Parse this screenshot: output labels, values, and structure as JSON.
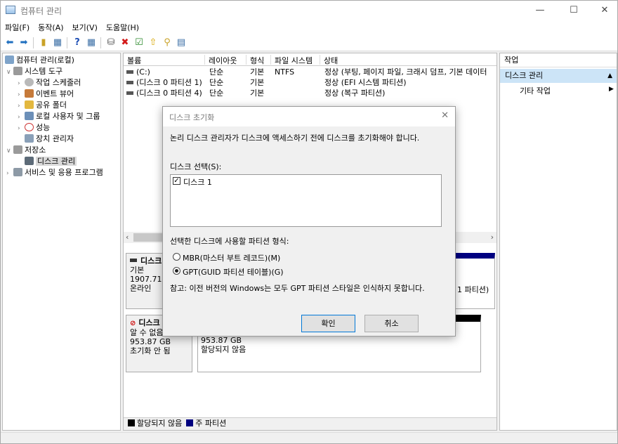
{
  "window": {
    "title": "컴퓨터 관리",
    "minimize": "—",
    "maximize": "☐",
    "close": "✕"
  },
  "menu": [
    "파일(F)",
    "동작(A)",
    "보기(V)",
    "도움말(H)"
  ],
  "tree": {
    "root": "컴퓨터 관리(로컬)",
    "system_tools": "시스템 도구",
    "task_scheduler": "작업 스케줄러",
    "event_viewer": "이벤트 뷰어",
    "shared_folders": "공유 폴더",
    "local_users": "로컬 사용자 및 그룹",
    "performance": "성능",
    "device_manager": "장치 관리자",
    "storage": "저장소",
    "disk_management": "디스크 관리",
    "services": "서비스 및 응용 프로그램"
  },
  "volumes": {
    "columns": [
      "볼륨",
      "레이아웃",
      "형식",
      "파일 시스템",
      "상태"
    ],
    "rows": [
      {
        "name": "(C:)",
        "layout": "단순",
        "type": "기본",
        "fs": "NTFS",
        "status": "정상 (부팅, 페이지 파일, 크래시 덤프, 기본 데이터"
      },
      {
        "name": "(디스크 0 파티션 1)",
        "layout": "단순",
        "type": "기본",
        "fs": "",
        "status": "정상 (EFI 시스템 파티션)"
      },
      {
        "name": "(디스크 0 파티션 4)",
        "layout": "단순",
        "type": "기본",
        "fs": "",
        "status": "정상 (복구 파티션)"
      }
    ]
  },
  "disk0": {
    "name": "디스크",
    "kind": "기본",
    "size": "1907.71 G",
    "state": "온라인",
    "part_fragment": "1 파티션)"
  },
  "disk1": {
    "name": "디스크",
    "kind": "알 수 없음",
    "size": "953.87 GB",
    "state": "초기화 안 됨",
    "part_size": "953.87 GB",
    "part_state": "할당되지 않음"
  },
  "legend": {
    "unallocated": "할당되지 않음",
    "primary": "주 파티션"
  },
  "actions": {
    "header": "작업",
    "section": "디스크 관리",
    "more": "기타 작업"
  },
  "dialog": {
    "title": "디스크 초기화",
    "message": "논리 디스크 관리자가 디스크에 액세스하기 전에 디스크를 초기화해야 합니다.",
    "select_label": "디스크 선택(S):",
    "disk_item": "디스크 1",
    "style_label": "선택한 디스크에 사용할 파티션 형식:",
    "mbr": "MBR(마스터 부트 레코드)(M)",
    "gpt": "GPT(GUID 파티션 테이블)(G)",
    "note": "참고: 이전 버전의 Windows는 모두 GPT 파티션 스타일은 인식하지 못합니다.",
    "ok": "확인",
    "cancel": "취소"
  },
  "colors": {
    "accent": "#0078d7",
    "primary_partition": "#000080",
    "unallocated": "#000000",
    "selection": "#cce4f7"
  }
}
